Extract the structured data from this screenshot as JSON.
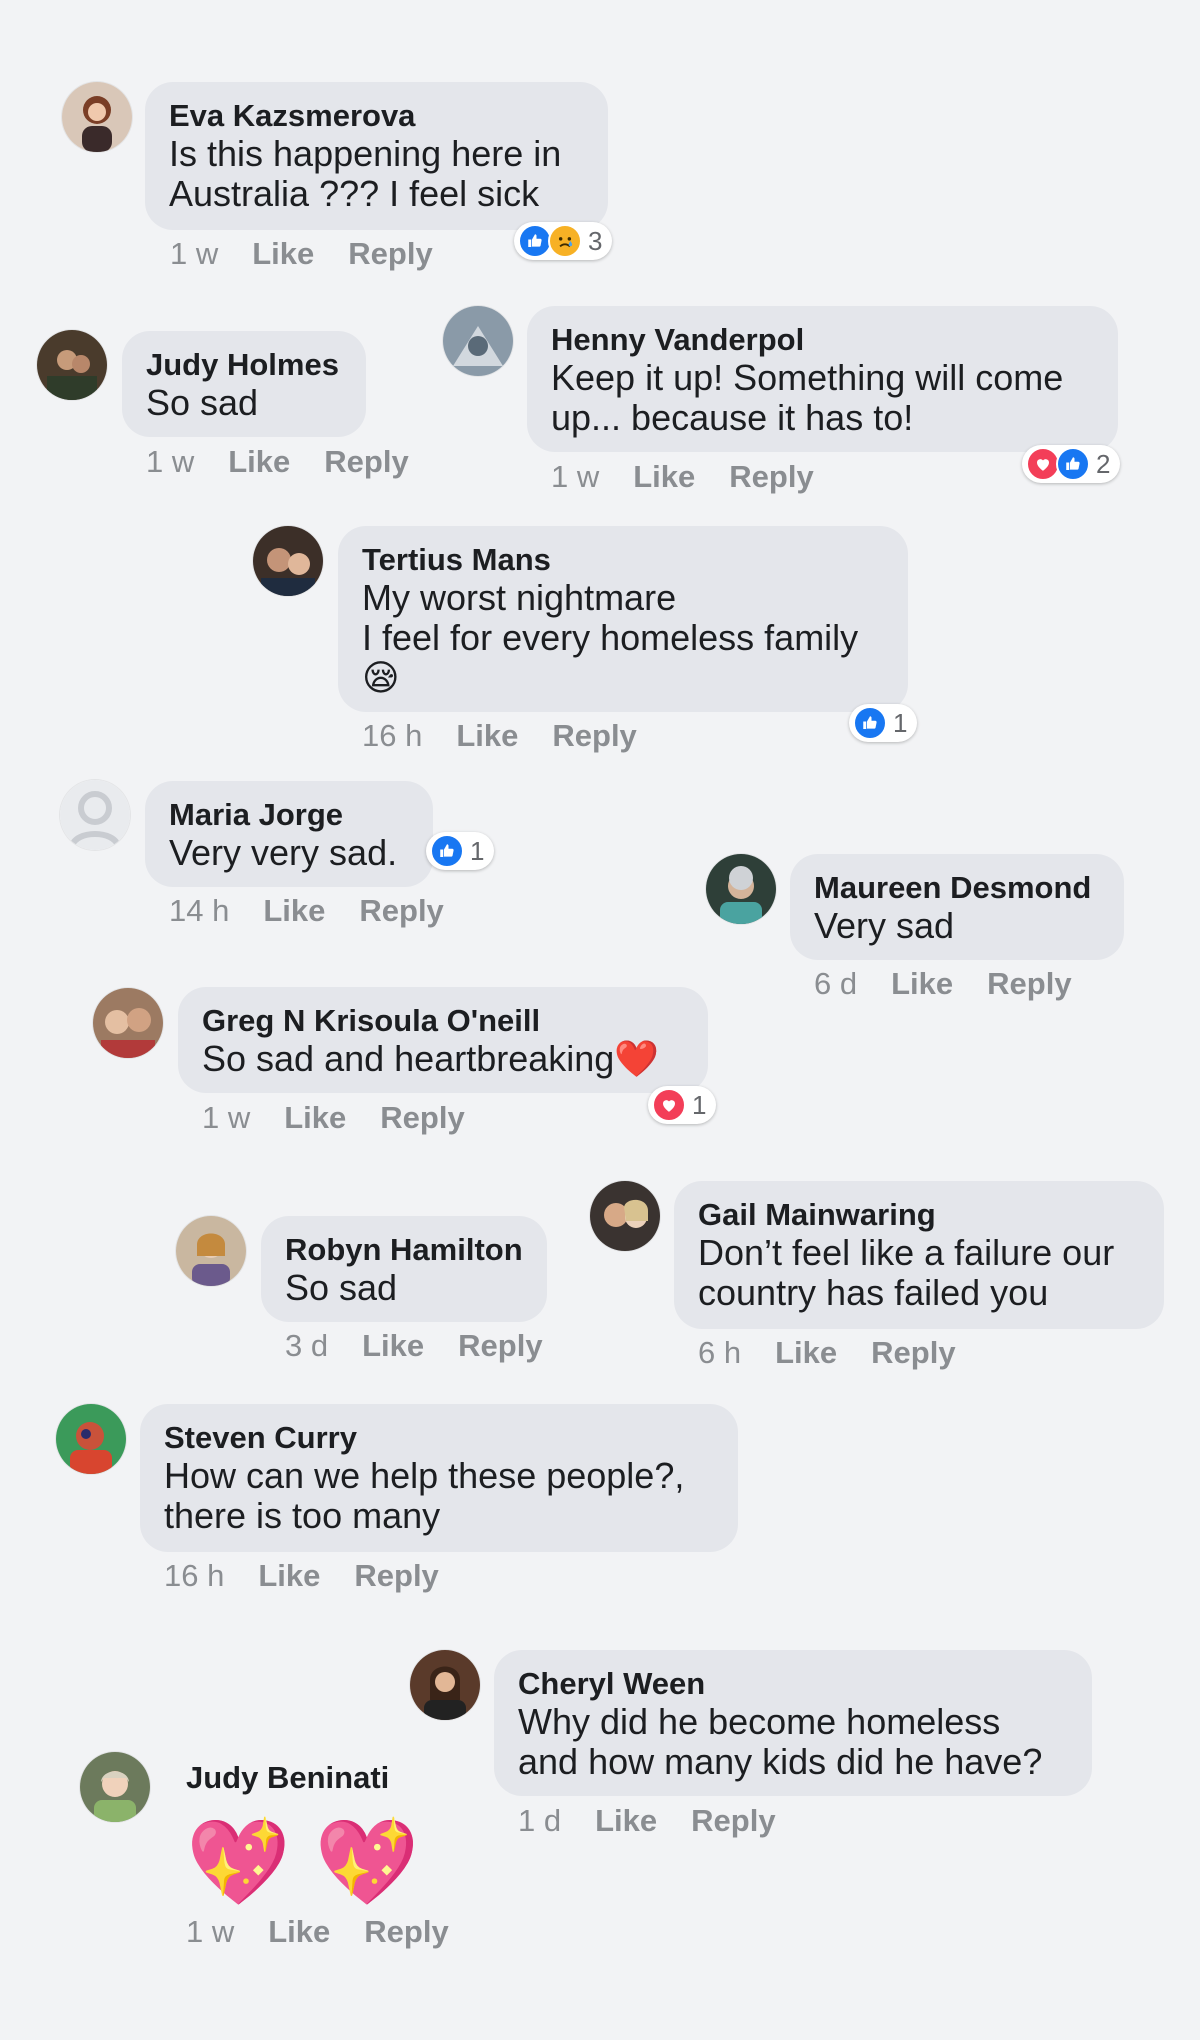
{
  "actions": {
    "like": "Like",
    "reply": "Reply"
  },
  "comments": [
    {
      "name": "Eva Kazsmerova",
      "text": "Is this happening here in\nAustralia ??? I feel sick",
      "time": "1 w",
      "reactions": {
        "icons": [
          "like-icon",
          "sad-icon"
        ],
        "count": "3"
      }
    },
    {
      "name": "Judy Holmes",
      "text": "So sad",
      "time": "1 w"
    },
    {
      "name": "Henny Vanderpol",
      "text": "Keep it up! Something will come\nup... because it has to!",
      "time": "1 w",
      "reactions": {
        "icons": [
          "love-icon",
          "like-icon"
        ],
        "count": "2"
      }
    },
    {
      "name": "Tertius Mans",
      "text": "My worst nightmare\nI feel for every homeless family",
      "emoji": "😪",
      "time": "16 h",
      "reactions": {
        "icons": [
          "like-icon"
        ],
        "count": "1"
      }
    },
    {
      "name": "Maria Jorge",
      "text": "Very very sad.",
      "time": "14 h",
      "reactions": {
        "icons": [
          "like-icon"
        ],
        "count": "1"
      }
    },
    {
      "name": "Maureen Desmond",
      "text": "Very sad",
      "time": "6 d"
    },
    {
      "name": "Greg N Krisoula O'neill",
      "text": "So sad and heartbreaking",
      "emoji": "❤️",
      "time": "1 w",
      "reactions": {
        "icons": [
          "love-icon"
        ],
        "count": "1"
      }
    },
    {
      "name": "Robyn Hamilton",
      "text": "So sad",
      "time": "3 d"
    },
    {
      "name": "Gail Mainwaring",
      "text": "Don’t feel like a failure our\ncountry has failed you",
      "time": "6 h"
    },
    {
      "name": "Steven Curry",
      "text": "How can we help these people?,\nthere is too many",
      "time": "16 h"
    },
    {
      "name": "Cheryl Ween",
      "text": "Why did he become homeless\nand how many kids did he have?",
      "time": "1 d"
    },
    {
      "name": "Judy Beninati",
      "emoji_big": [
        "💖",
        "💖"
      ],
      "time": "1 w"
    }
  ]
}
